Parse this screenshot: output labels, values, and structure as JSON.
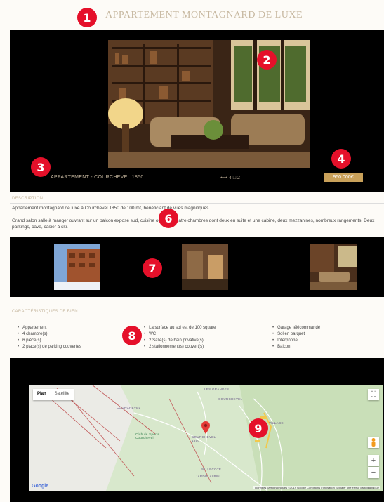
{
  "page": {
    "title": "APPARTEMENT MONTAGNARD DE LUXE",
    "badges": [
      "1",
      "2",
      "3",
      "4",
      "6",
      "7",
      "8",
      "9"
    ]
  },
  "hero": {
    "caption": "APPARTEMENT - COURCHEVEL 1850",
    "stats": "⟷ 4   □ 2",
    "price": "950.000€"
  },
  "description": {
    "heading": "DESCRIPTION",
    "paragraph1": "Appartement montagnard de luxe à Courchevel 1850 de 100 m², bénéficiant de vues magnifiques.",
    "paragraph2": "Grand salon salle à manger ouvrant sur un balcon exposé sud, cuisine ouverte, quatre chambres dont deux en suite et une cabine, deux mezzanines, nombreux rangements. Deux parkings, cave, casier à ski."
  },
  "features": {
    "heading": "CARACTÉRISTIQUES DE BIEN",
    "col1": [
      "Appartement",
      "4 chambre(s)",
      "6 pièce(s)",
      "2 place(s) de parking couvertes"
    ],
    "col2": [
      "La surface au sol est de 100 square",
      "WC",
      "2 Salle(s) de bain privative(s)",
      "2 stationnement(s) couvert(s)"
    ],
    "col3": [
      "Garage télécommandé",
      "Sol en parquet",
      "Interphone",
      "Balcon"
    ]
  },
  "map": {
    "tab_plan": "Plan",
    "tab_satellite": "Satellite",
    "labels": {
      "courchevel": "COURCHEVEL",
      "courchevel2": "COURCHEVEL",
      "marker": "COURCHEVEL 1850",
      "bellecote": "BELLECOTE",
      "village": "VILLAGE",
      "park": "Club de Sports Courchevel",
      "bottom": "JARDIN ALPIN",
      "top": "LES GRANDES"
    },
    "footer": "Données cartographiques ©2019 Google  Conditions d'utilisation  Signaler une erreur cartographique",
    "google": "Google",
    "fullscreen": "⛶",
    "zoom_in": "+",
    "zoom_out": "−"
  }
}
